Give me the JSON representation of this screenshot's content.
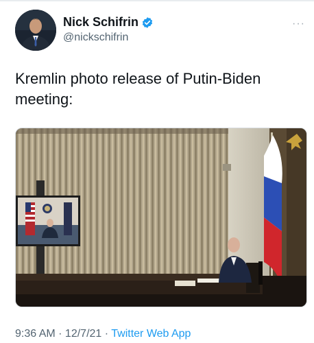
{
  "author": {
    "display_name": "Nick Schifrin",
    "handle": "@nickschifrin",
    "verified": true,
    "avatar_icon": "profile-photo"
  },
  "tweet": {
    "text": "Kremlin photo release of Putin-Biden meeting:",
    "media_description_icon": "photo"
  },
  "meta": {
    "time": "9:36 AM",
    "separator": " · ",
    "date": "12/7/21",
    "source": "Twitter Web App"
  },
  "colors": {
    "verified_blue": "#1d9bf0",
    "link_blue": "#1d9bf0",
    "secondary_text": "#536471"
  }
}
